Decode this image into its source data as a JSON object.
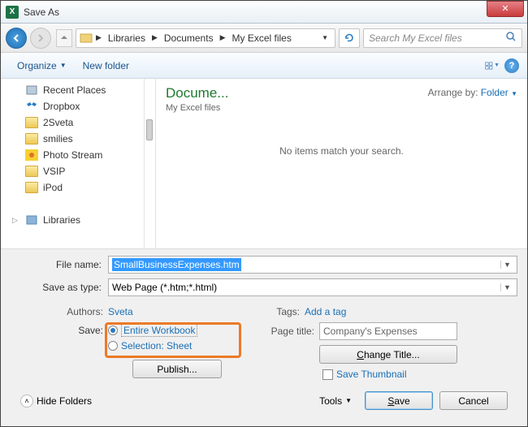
{
  "title": "Save As",
  "breadcrumb": {
    "l1": "Libraries",
    "l2": "Documents",
    "l3": "My Excel files"
  },
  "search": {
    "placeholder": "Search My Excel files"
  },
  "toolbar": {
    "organize": "Organize",
    "newfolder": "New folder"
  },
  "tree": {
    "recent": "Recent Places",
    "dropbox": "Dropbox",
    "sveta": "2Sveta",
    "smilies": "smilies",
    "photo": "Photo Stream",
    "vsip": "VSIP",
    "ipod": "iPod",
    "libraries": "Libraries"
  },
  "detail": {
    "title": "Docume...",
    "sub": "My Excel files",
    "arrange_lbl": "Arrange by:",
    "arrange_val": "Folder",
    "empty": "No items match your search."
  },
  "form": {
    "filename_lbl": "File name:",
    "filename_val": "SmallBusinessExpenses.htm",
    "saveastype_lbl": "Save as type:",
    "saveastype_val": "Web Page (*.htm;*.html)",
    "authors_lbl": "Authors:",
    "authors_val": "Sveta",
    "tags_lbl": "Tags:",
    "tags_val": "Add a tag",
    "save_lbl": "Save:",
    "save_opt1": "Entire Workbook",
    "save_opt2": "Selection: Sheet",
    "publish": "Publish...",
    "pagetitle_lbl": "Page title:",
    "pagetitle_val": "Company's Expenses",
    "changetitle": "Change Title...",
    "savethumbnail": "Save Thumbnail"
  },
  "footer": {
    "hide": "Hide Folders",
    "tools": "Tools",
    "save": "Save",
    "cancel": "Cancel"
  }
}
